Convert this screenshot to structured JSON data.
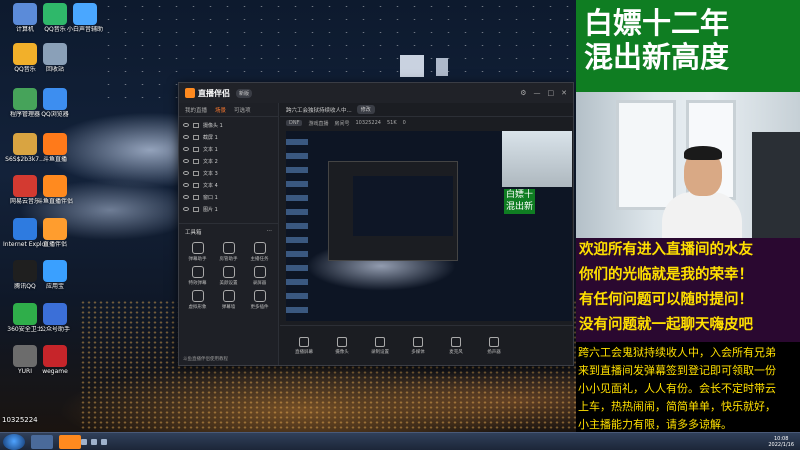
{
  "desktop": {
    "icons": [
      {
        "label": "计算机",
        "icon": "computer-icon",
        "color": "#5b8bd9"
      },
      {
        "label": "QQ音乐",
        "icon": "qq-music-icon",
        "color": "#2fb86a"
      },
      {
        "label": "小白声音辅助",
        "icon": "sound-icon",
        "color": "#4aa7ff"
      },
      {
        "label": "QQ音乐",
        "icon": "qq-music-icon-2",
        "color": "#f2b02a"
      },
      {
        "label": "回收站",
        "icon": "recycle-bin-icon",
        "color": "#8aa0b8"
      },
      {
        "label": "程序管理器",
        "icon": "app-manager-icon",
        "color": "#46a35a"
      },
      {
        "label": "QQ浏览器",
        "icon": "qq-browser-icon",
        "color": "#3d8ef0"
      },
      {
        "label": "S6S$2b3k7...",
        "icon": "folder-icon",
        "color": "#d9a441"
      },
      {
        "label": "斗鱼直播",
        "icon": "douyu-icon",
        "color": "#ff7a1a"
      },
      {
        "label": "网易云音乐",
        "icon": "netease-music-icon",
        "color": "#d33a31"
      },
      {
        "label": "斗鱼直播伴侣",
        "icon": "douyu-assistant-icon",
        "color": "#ff8a1f"
      },
      {
        "label": "Internet Explorer",
        "icon": "ie-icon",
        "color": "#2e7be0"
      },
      {
        "label": "直播伴侣",
        "icon": "live-assistant-icon",
        "color": "#ff9d2e"
      },
      {
        "label": "腾讯QQ",
        "icon": "qq-icon",
        "color": "#1f1f1f"
      },
      {
        "label": "应用宝",
        "icon": "app-store-icon",
        "color": "#3aa0ff"
      },
      {
        "label": "360安全卫士",
        "icon": "security-icon",
        "color": "#2fae4a"
      },
      {
        "label": "公众号助手",
        "icon": "assistant-icon",
        "color": "#3b6fd8"
      },
      {
        "label": "YURI",
        "icon": "yuri-icon",
        "color": "#6c6c6c"
      },
      {
        "label": "wegame",
        "icon": "wegame-icon",
        "color": "#c6252a"
      }
    ],
    "room_id": "10325224"
  },
  "app": {
    "name": "直播伴侣",
    "version_badge": "新版",
    "tabs": [
      "我的直播",
      "场景",
      "可选项"
    ],
    "active_tab": "场景",
    "scenes": [
      "摄像头 1",
      "截屏 1",
      "文本 1",
      "文本 2",
      "文本 3",
      "文本 4",
      "窗口 1",
      "图片 1"
    ],
    "tools_title": "工具箱",
    "tools": [
      "弹幕助手",
      "房管助手",
      "主播任务",
      "特效弹幕",
      "美颜设置",
      "录屏器",
      "虚拟形象",
      "弹幕墙",
      "更多插件"
    ],
    "footer": "斗鱼直播伴侣使用教程",
    "top_title": "跨六工会独狱持续收人中...",
    "top_button": "修改",
    "info": {
      "tag": "DNF",
      "category": "游戏直播",
      "room_label": "房间号",
      "room_no": "10325224",
      "stat1": "51K",
      "stat2": "0"
    },
    "bottom_tools": [
      "直播屏幕",
      "摄像头",
      "录制设置",
      "多媒体",
      "麦克风",
      "扬声器"
    ]
  },
  "overlay": {
    "title_lines": [
      "白嫖十二年",
      "混出新高度"
    ],
    "welcome_lines": [
      "欢迎所有进入直播间的水友",
      "你们的光临就是我的荣幸！",
      "有任何问题可以随时提问！",
      "没有问题就一起聊天嗨皮吧"
    ],
    "notice_lines": [
      "跨六工会鬼狱持续收人中，入会所有兄弟",
      "来到直播间发弹幕签到登记即可领取一份",
      "小小见面礼，人人有份。会长不定时带云",
      "上车，热热闹闹，简简单单，快乐就好，",
      "小主播能力有限，请多多谅解。"
    ],
    "colors": {
      "title_bg": "#0f7d22",
      "welcome_bg": "#2a0830",
      "welcome_text": "#ffe000",
      "notice_bg": "#000000"
    }
  },
  "preview": {
    "title_small_1": "白嫖十",
    "title_small_2": "混出新"
  },
  "taskbar": {
    "time": "10:08",
    "date": "2022/1/16"
  }
}
